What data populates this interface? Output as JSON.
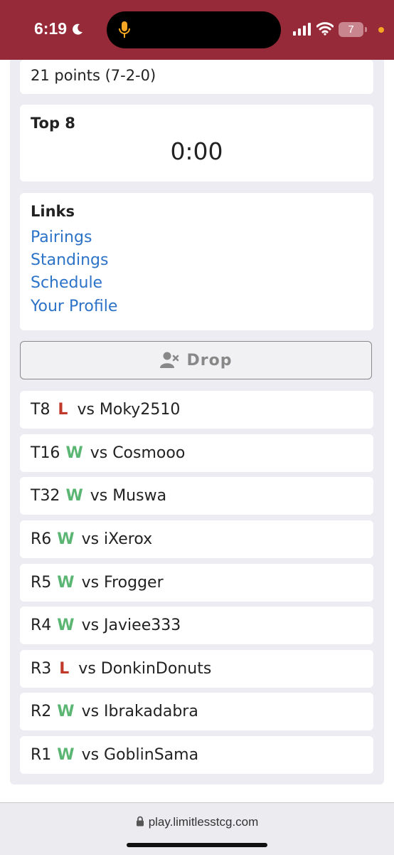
{
  "status_bar": {
    "time": "6:19",
    "battery": "7"
  },
  "record": {
    "points_text": "21 points (7-2-0)"
  },
  "phase": {
    "title": "Top 8",
    "timer": "0:00"
  },
  "links": {
    "title": "Links",
    "items": [
      "Pairings",
      "Standings",
      "Schedule",
      "Your Profile"
    ],
    "color": "#2c73c8"
  },
  "drop_button": {
    "label": "Drop",
    "icon": "user-x-icon"
  },
  "matches": [
    {
      "round": "T8",
      "result": "L",
      "opponent": "vs Moky2510"
    },
    {
      "round": "T16",
      "result": "W",
      "opponent": "vs Cosmooo"
    },
    {
      "round": "T32",
      "result": "W",
      "opponent": "vs Muswa"
    },
    {
      "round": "R6",
      "result": "W",
      "opponent": "vs iXerox"
    },
    {
      "round": "R5",
      "result": "W",
      "opponent": "vs Frogger"
    },
    {
      "round": "R4",
      "result": "W",
      "opponent": "vs Javiee333"
    },
    {
      "round": "R3",
      "result": "L",
      "opponent": "vs DonkinDonuts"
    },
    {
      "round": "R2",
      "result": "W",
      "opponent": "vs Ibrakadabra"
    },
    {
      "round": "R1",
      "result": "W",
      "opponent": "vs GoblinSama"
    }
  ],
  "colors": {
    "win": "#5bb573",
    "loss": "#c0392b",
    "status_bar": "#962a38"
  },
  "url_bar": {
    "url": "play.limitlesstcg.com"
  }
}
